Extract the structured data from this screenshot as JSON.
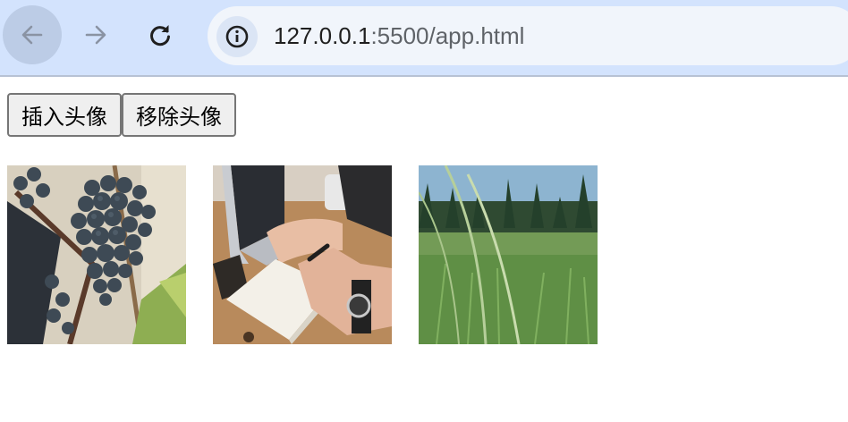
{
  "browser": {
    "url_host": "127.0.0.1",
    "url_rest": ":5500/app.html",
    "icons": {
      "back": "arrow-left-icon",
      "forward": "arrow-right-icon",
      "reload": "reload-icon",
      "info": "info-icon"
    }
  },
  "toolbar": {
    "insert_label": "插入头像",
    "remove_label": "移除头像"
  },
  "gallery": {
    "images": [
      {
        "subject": "grapes-photo"
      },
      {
        "subject": "person-writing-notebook-photo"
      },
      {
        "subject": "grass-field-photo"
      }
    ]
  },
  "colors": {
    "chrome": "#d3e3fd",
    "url_bg": "#f1f5fb",
    "button_bg": "#efefef"
  }
}
